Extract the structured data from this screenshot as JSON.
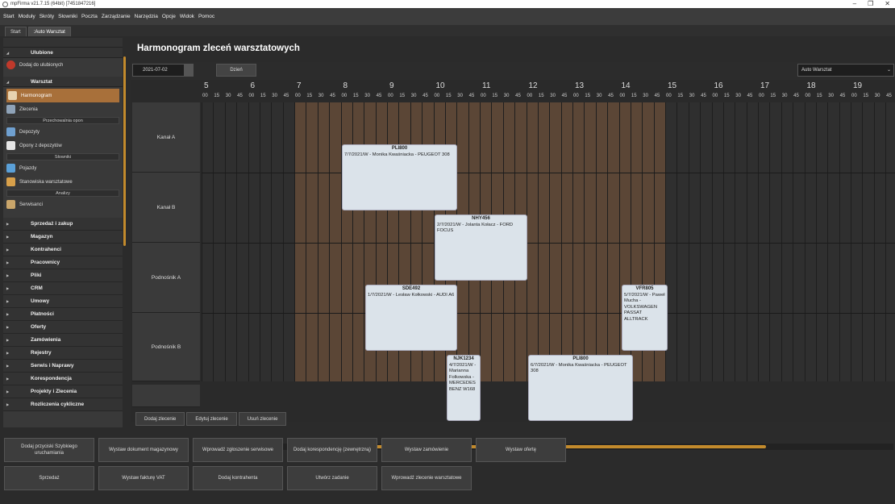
{
  "window": {
    "title": "mpFirma v21.7.15 (64bit) [7451847216]"
  },
  "menu": [
    "Start",
    "Moduły",
    "Skróty",
    "Słowniki",
    "Poczta",
    "Zarządzanie",
    "Narzędzia",
    "Opcje",
    "Widok",
    "Pomoc"
  ],
  "tabs": [
    "Start",
    ":Auto Warsztat"
  ],
  "sidebar": {
    "favorites_header": "Ulubione",
    "add_favorite": "Dodaj do ulubionych",
    "workshop_header": "Warsztat",
    "workshop_items": [
      {
        "label": "Harmonogram",
        "icon": "calendar-icon",
        "active": true
      },
      {
        "label": "Zlecenia",
        "icon": "wrench-icon"
      }
    ],
    "group1": "Przechowalnia opon",
    "storage_items": [
      {
        "label": "Depozyty",
        "icon": "storage-icon"
      },
      {
        "label": "Opony z depozytów",
        "icon": "document-icon"
      }
    ],
    "group2": "Słowniki",
    "dict_items": [
      {
        "label": "Pojazdy",
        "icon": "car-icon"
      },
      {
        "label": "Stanowiska warsztatowe",
        "icon": "lift-icon"
      }
    ],
    "group3": "Analizy",
    "analysis_items": [
      {
        "label": "Serwisanci",
        "icon": "mechanic-icon"
      }
    ],
    "modules": [
      "Sprzedaż i zakup",
      "Magazyn",
      "Kontrahenci",
      "Pracownicy",
      "Pliki",
      "CRM",
      "Umowy",
      "Płatności",
      "Oferty",
      "Zamówienia",
      "Rejestry",
      "Serwis i Naprawy",
      "Korespondencja",
      "Projekty i Zlecenia",
      "Rozliczenia cykliczne"
    ]
  },
  "main": {
    "title": "Harmonogram zleceń warsztatowych",
    "date": "2021-07-02",
    "view_button": "Dzień",
    "workshop_select": "Auto Warsztat",
    "hours": [
      "5",
      "6",
      "7",
      "8",
      "9",
      "10",
      "11",
      "12",
      "13",
      "14",
      "15",
      "16",
      "17",
      "18",
      "19"
    ],
    "minute_labels": [
      "00",
      "15",
      "30",
      "45"
    ],
    "resources": [
      "Kanał A",
      "Kanał B",
      "Podnośnik A",
      "Podnośnik B"
    ],
    "events": [
      {
        "reg": "PLI800",
        "desc": "7/7/2021/W - Monika Kwaśniacka - PEUGEOT 308",
        "row": 0
      },
      {
        "reg": "NHY456",
        "desc": "2/7/2021/W - Jolanta Kołacz - FORD FOCUS",
        "row": 1
      },
      {
        "reg": "SDE492",
        "desc": "1/7/2021/W - Lesław Kołkowski - AUDI A6",
        "row": 2
      },
      {
        "reg": "VFR805",
        "desc": "5/7/2021/W - Paweł Mucha - VOLKSWAGEN PASSAT ALLTRACK",
        "row": 2
      },
      {
        "reg": "NJK1234",
        "desc": "4/7/2021/W - Marianna Folkowska - MERCEDES BENZ W168",
        "row": 3
      },
      {
        "reg": "PLI800",
        "desc": "6/7/2021/W - Monika Kwaśniacka - PEUGEOT 308",
        "row": 3
      }
    ],
    "actions": [
      "Dodaj zlecenie",
      "Edytuj zlecenie",
      "Usuń zlecenie"
    ]
  },
  "shortcuts": [
    "Dodaj przyciski Szybkiego uruchamiania",
    "Wystaw dokument magazynowy",
    "Wprowadź zgłoszenie serwisowe",
    "Dodaj korespondencję (zewnętrzną)",
    "Wystaw zamówienie",
    "Wystaw ofertę",
    "Sprzedaż",
    "Wystaw fakturę VAT",
    "Dodaj kontrahenta",
    "Utwórz zadanie",
    "Wprowadź zlecenie warsztatowe"
  ],
  "colors": {
    "accent": "#a8703a",
    "worktime": "#5b4636",
    "offtime": "#2f2f2f",
    "event": "#dbe3ea"
  }
}
